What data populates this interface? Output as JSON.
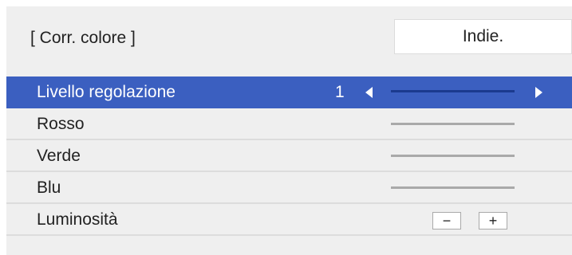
{
  "header": {
    "title": "[ Corr. colore ]",
    "mode_button_label": "Indie."
  },
  "menu": {
    "rows": [
      {
        "label": "Livello regolazione",
        "value": "1",
        "selected": true
      },
      {
        "label": "Rosso"
      },
      {
        "label": "Verde"
      },
      {
        "label": "Blu"
      },
      {
        "label": "Luminosità",
        "minus_label": "−",
        "plus_label": "+"
      }
    ]
  },
  "colors": {
    "panel_bg": "#efefef",
    "selected_bg": "#3b5fc0",
    "selected_text": "#ffffff",
    "track_gray": "#a9a9a9",
    "track_selected": "#1b3a8e"
  },
  "icons": {
    "decrease": "triangle-left-icon",
    "increase": "triangle-right-icon"
  }
}
